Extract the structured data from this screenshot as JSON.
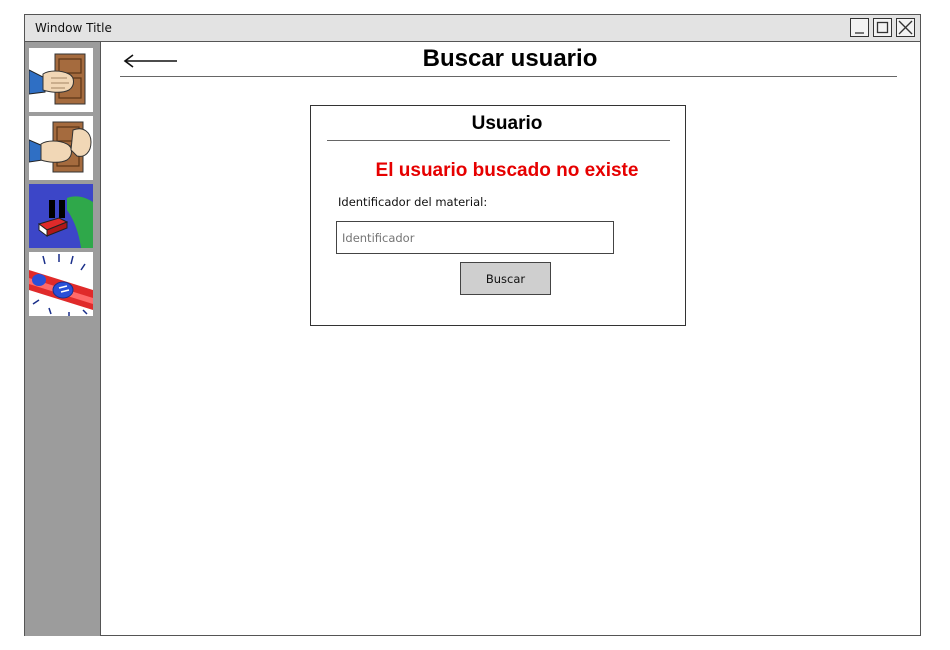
{
  "window": {
    "title": "Window Title"
  },
  "sidebar": {
    "items": [
      {
        "icon": "door-knock-icon"
      },
      {
        "icon": "door-knock-open-icon"
      },
      {
        "icon": "pause-book-icon"
      },
      {
        "icon": "alert-siren-icon"
      }
    ]
  },
  "header": {
    "back_icon": "back-arrow-icon",
    "title": "Buscar usuario"
  },
  "card": {
    "title": "Usuario",
    "error": "El usuario buscado no existe",
    "field_label": "Identificador del material:",
    "input_placeholder": "Identificador",
    "button_label": "Buscar"
  },
  "colors": {
    "error": "#e60000",
    "sidebar": "#9c9c9c",
    "titlebar": "#e3e3e3"
  }
}
